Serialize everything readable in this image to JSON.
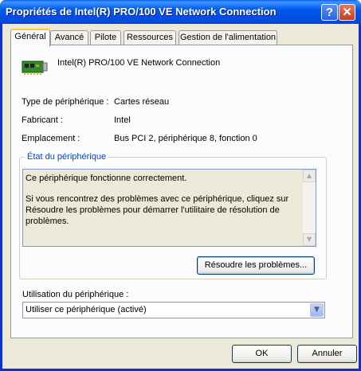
{
  "window": {
    "title": "Propriétés de Intel(R) PRO/100 VE Network Connection",
    "help_icon": "help-icon",
    "close_icon": "close-icon"
  },
  "tabs": [
    {
      "label": "Général",
      "active": true
    },
    {
      "label": "Avancé"
    },
    {
      "label": "Pilote"
    },
    {
      "label": "Ressources"
    },
    {
      "label": "Gestion de l'alimentation"
    }
  ],
  "general": {
    "device_icon": "network-card-icon",
    "device_name": "Intel(R) PRO/100 VE Network Connection",
    "type_label": "Type de périphérique :",
    "type_value": "Cartes réseau",
    "maker_label": "Fabricant :",
    "maker_value": "Intel",
    "location_label": "Emplacement :",
    "location_value": "Bus PCI 2, périphérique 8, fonction 0",
    "status_group_title": "État du périphérique",
    "status_line1": "Ce périphérique fonctionne correctement.",
    "status_line2": "Si vous rencontrez des problèmes avec ce périphérique, cliquez sur Résoudre les problèmes pour démarrer l'utilitaire de résolution de problèmes.",
    "resolve_button": "Résoudre les problèmes...",
    "usage_label": "Utilisation du périphérique :",
    "usage_value": "Utiliser ce périphérique (activé)"
  },
  "footer": {
    "ok": "OK",
    "cancel": "Annuler"
  },
  "colors": {
    "titlebar": "#0058ee",
    "dialog_bg": "#ece9d8",
    "group_title": "#0046d5",
    "active_tab_accent": "#ffc83c"
  }
}
